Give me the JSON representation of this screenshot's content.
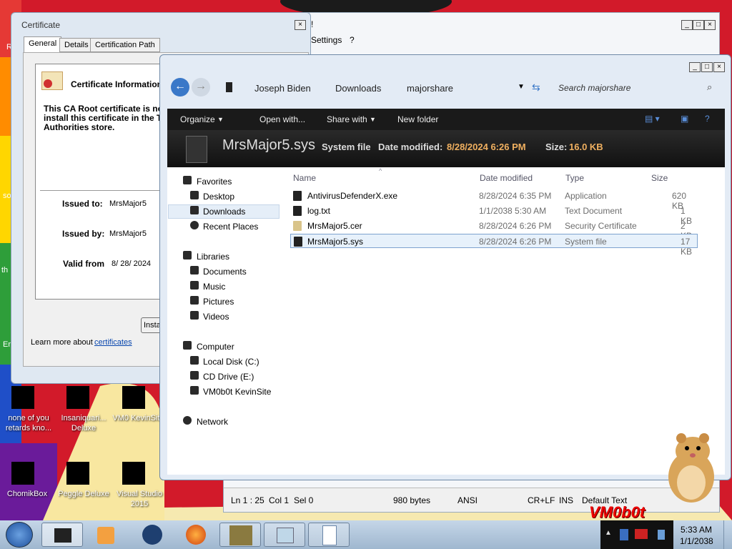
{
  "desktop": {
    "icons": [
      {
        "label": "none of you retards kno...",
        "name": "desktop-icon-none-of-you"
      },
      {
        "label": "Insaniquari... Deluxe",
        "name": "desktop-icon-insaniquarium"
      },
      {
        "label": "VM0 KevinSit...",
        "name": "desktop-icon-vm0-kevinsite"
      },
      {
        "label": "ChomikBox",
        "name": "desktop-icon-chomikbox"
      },
      {
        "label": "Peggle Deluxe",
        "name": "desktop-icon-peggle"
      },
      {
        "label": "Visual Studio 2015",
        "name": "desktop-icon-visual-studio"
      }
    ],
    "edge_text": [
      "R",
      "so",
      "th",
      "En"
    ]
  },
  "certificate": {
    "title": "Certificate",
    "tabs": [
      "General",
      "Details",
      "Certification Path"
    ],
    "info_heading": "Certificate Information",
    "warning_line1": "This CA Root certificate is not",
    "warning_line2": "install this certificate in the T",
    "warning_line3": "Authorities store.",
    "issued_to_label": "Issued to:",
    "issued_to_value": "MrsMajor5",
    "issued_by_label": "Issued by:",
    "issued_by_value": "MrsMajor5",
    "valid_from_label": "Valid from",
    "valid_from_value": "8/ 28/ 2024",
    "install_button": "Insta",
    "learn_more_prefix": "Learn more about",
    "learn_more_link": "certificates"
  },
  "notepad": {
    "menu": [
      "Settings",
      "?"
    ],
    "menu_partial": "!",
    "status": {
      "position": "Ln 1 : 25",
      "col": "Col 1",
      "sel": "Sel 0",
      "size": "980 bytes",
      "encoding": "ANSI",
      "eol": "CR+LF",
      "mode": "INS",
      "style": "Default Text"
    }
  },
  "explorer": {
    "breadcrumb": [
      "Joseph Biden",
      "Downloads",
      "majorshare"
    ],
    "search_placeholder": "Search majorshare",
    "toolbar": {
      "organize": "Organize",
      "open_with": "Open with...",
      "share_with": "Share with",
      "new_folder": "New folder"
    },
    "details": {
      "filename": "MrsMajor5.sys",
      "type": "System file",
      "modified_label": "Date modified:",
      "modified_value": "8/28/2024 6:26 PM",
      "size_label": "Size:",
      "size_value": "16.0 KB"
    },
    "nav": {
      "favorites": "Favorites",
      "favorites_items": [
        "Desktop",
        "Downloads",
        "Recent Places"
      ],
      "libraries": "Libraries",
      "libraries_items": [
        "Documents",
        "Music",
        "Pictures",
        "Videos"
      ],
      "computer": "Computer",
      "computer_items": [
        "Local Disk (C:)",
        "CD Drive (E:)",
        "VM0b0t KevinSite"
      ],
      "network": "Network"
    },
    "columns": [
      "Name",
      "Date modified",
      "Type",
      "Size"
    ],
    "files": [
      {
        "name": "AntivirusDefenderX.exe",
        "modified": "8/28/2024 6:35 PM",
        "type": "Application",
        "size": "620 KB"
      },
      {
        "name": "log.txt",
        "modified": "1/1/2038 5:30 AM",
        "type": "Text Document",
        "size": "1 KB"
      },
      {
        "name": "MrsMajor5.cer",
        "modified": "8/28/2024 6:26 PM",
        "type": "Security Certificate",
        "size": "2 KB"
      },
      {
        "name": "MrsMajor5.sys",
        "modified": "8/28/2024 6:26 PM",
        "type": "System file",
        "size": "17 KB"
      }
    ]
  },
  "taskbar": {
    "time": "5:33 AM",
    "date": "1/1/2038"
  },
  "watermark": "VM0b0t"
}
